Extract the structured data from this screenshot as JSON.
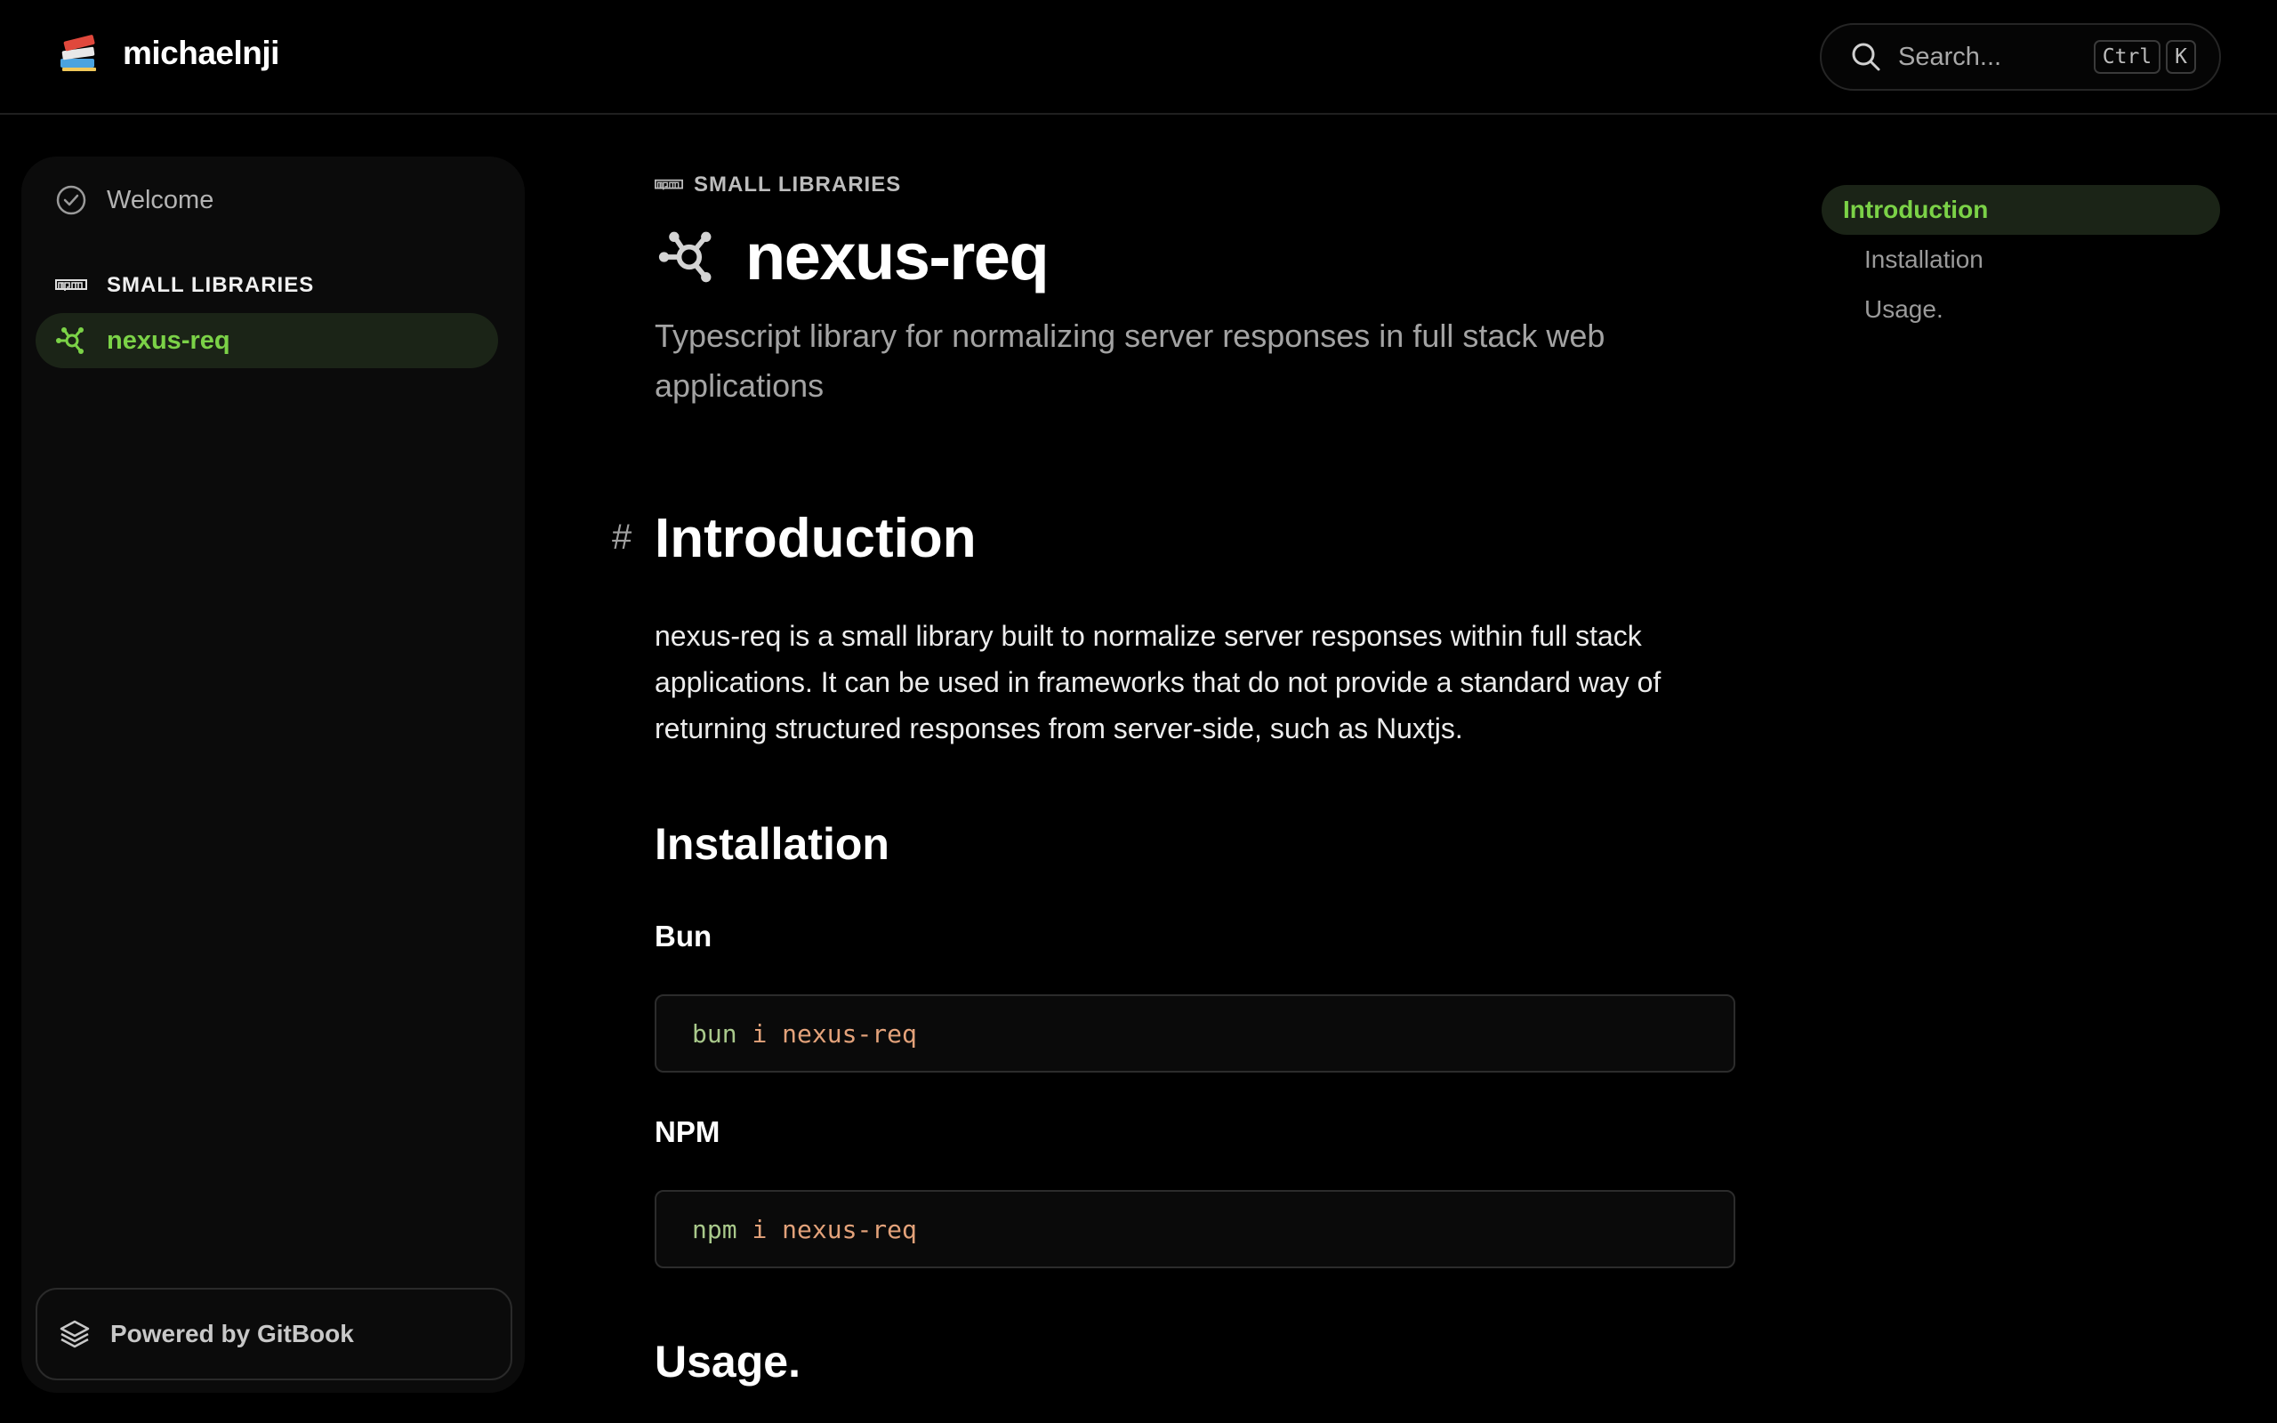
{
  "header": {
    "brand": "michaelnji",
    "search_placeholder": "Search...",
    "kbd_ctrl": "Ctrl",
    "kbd_k": "K"
  },
  "sidebar": {
    "welcome": "Welcome",
    "section": "SMALL LIBRARIES",
    "active_item": "nexus-req",
    "powered_by": "Powered by GitBook"
  },
  "page": {
    "breadcrumb": "SMALL LIBRARIES",
    "title": "nexus-req",
    "subtitle": "Typescript library for normalizing server responses in full stack web applications",
    "anchor": "#",
    "intro_heading": "Introduction",
    "intro_text": "nexus-req is a small library built to normalize server responses within full stack applications. It can be used in frameworks that do not provide a standard way of returning structured responses from server-side, such as Nuxtjs.",
    "install_heading": "Installation",
    "bun_label": "Bun",
    "bun_cmd": "bun",
    "bun_args": "i nexus-req",
    "npm_label": "NPM",
    "npm_cmd": "npm",
    "npm_args": "i nexus-req",
    "usage_heading": "Usage."
  },
  "toc": {
    "items": [
      "Introduction",
      "Installation",
      "Usage."
    ]
  },
  "colors": {
    "accent": "#7bd247",
    "active_bg": "#1b2417",
    "background": "#000000"
  }
}
